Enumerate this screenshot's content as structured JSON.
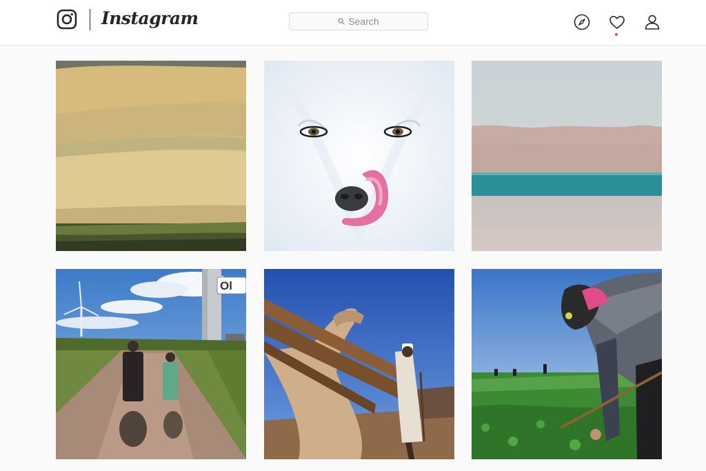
{
  "header": {
    "wordmark": "Instagram",
    "search_placeholder": "Search",
    "icons": [
      "instagram-glyph-icon",
      "search-icon",
      "explore-compass-icon",
      "heart-icon",
      "profile-icon"
    ],
    "activity_dot_color": "#ed4956"
  },
  "feed": {
    "posts": [
      {
        "subject": "desert sand dunes"
      },
      {
        "subject": "white arctic fox licking nose"
      },
      {
        "subject": "lake with distant mountains"
      },
      {
        "subject": "two people walking on dirt road near wind turbine",
        "overlay_text": "Ol"
      },
      {
        "subject": "camel carrying logs beside a man"
      },
      {
        "subject": "farmer working in green field"
      }
    ]
  }
}
